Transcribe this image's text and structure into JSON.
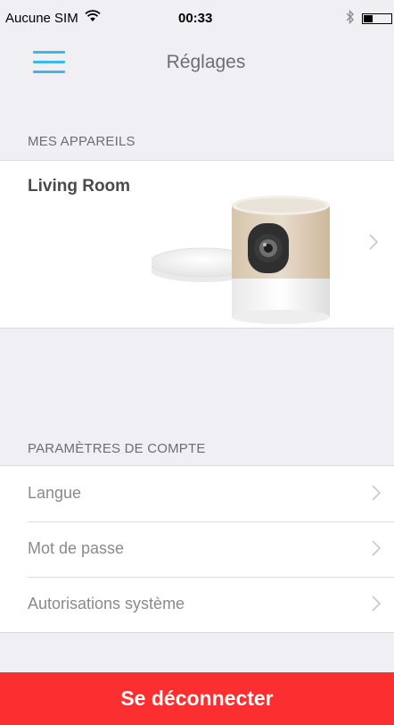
{
  "status_bar": {
    "carrier": "Aucune SIM",
    "time": "00:33",
    "wifi_icon": "wifi-icon",
    "bluetooth_icon": "bluetooth-icon",
    "battery_level": 0.3
  },
  "nav": {
    "title": "Réglages",
    "menu_icon": "hamburger-icon",
    "accent_color": "#3cb9e7"
  },
  "devices_section": {
    "header": "MES APPAREILS",
    "items": [
      {
        "name": "Living Room",
        "image": "camera-device-image"
      }
    ]
  },
  "account_section": {
    "header": "PARAMÈTRES DE COMPTE",
    "items": [
      {
        "label": "Langue"
      },
      {
        "label": "Mot de passe"
      },
      {
        "label": "Autorisations système"
      }
    ]
  },
  "logout": {
    "label": "Se déconnecter",
    "color": "#fb2f2f"
  }
}
